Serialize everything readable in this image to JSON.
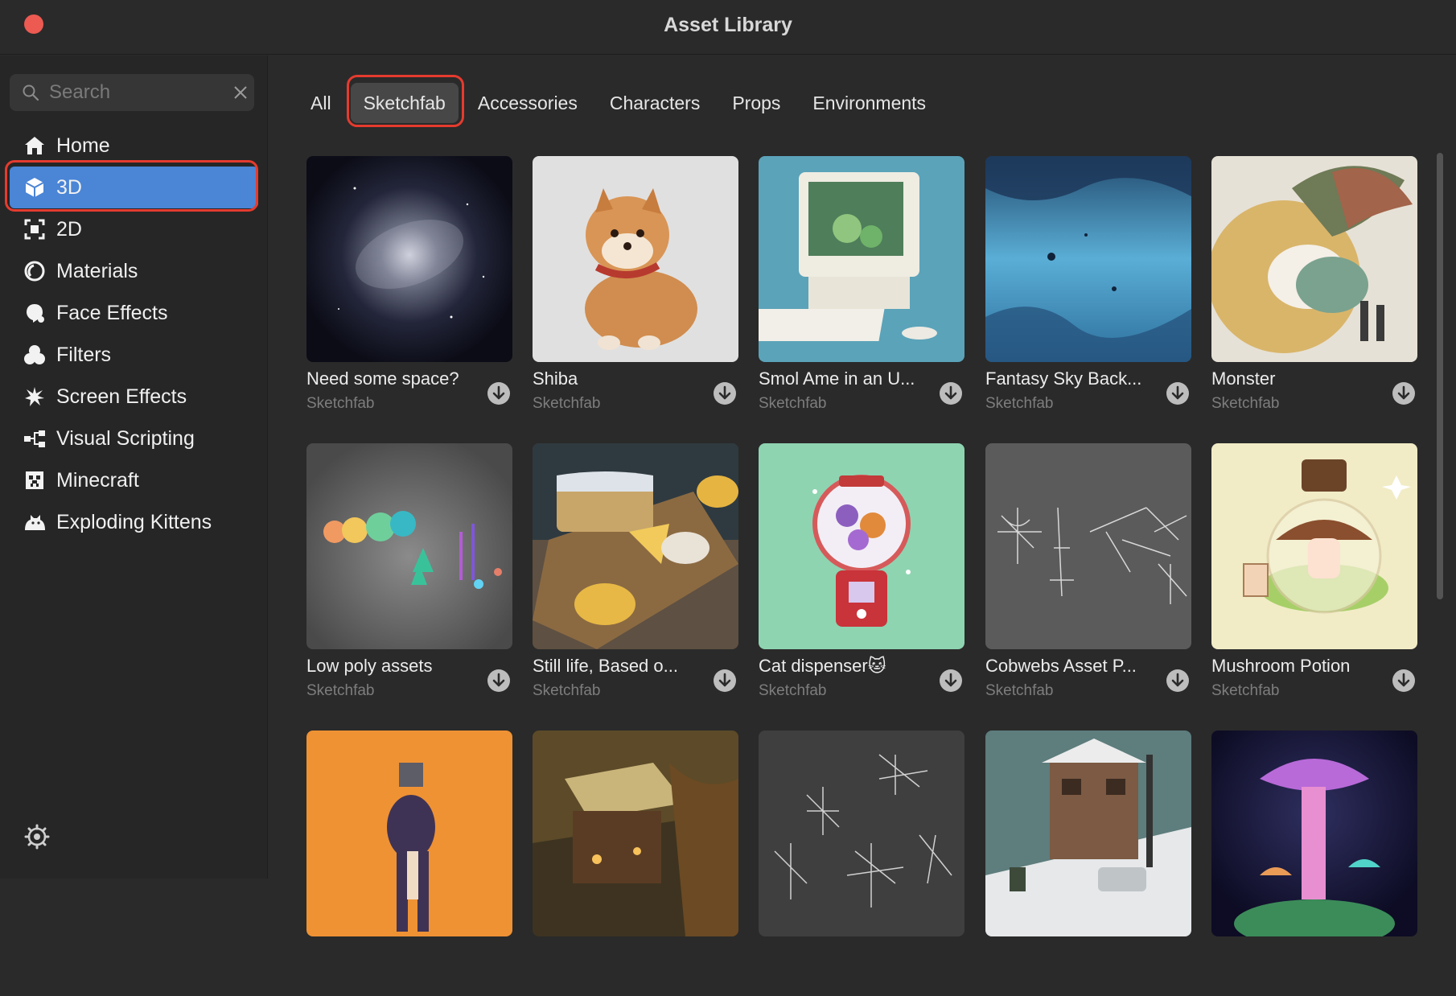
{
  "window": {
    "title": "Asset Library"
  },
  "search": {
    "placeholder": "Search",
    "value": ""
  },
  "sidebar": {
    "items": [
      {
        "label": "Home",
        "icon": "home-icon"
      },
      {
        "label": "3D",
        "icon": "cube-icon",
        "active": true
      },
      {
        "label": "2D",
        "icon": "frame-icon"
      },
      {
        "label": "Materials",
        "icon": "materials-icon"
      },
      {
        "label": "Face Effects",
        "icon": "face-effects-icon"
      },
      {
        "label": "Filters",
        "icon": "filters-icon"
      },
      {
        "label": "Screen Effects",
        "icon": "screen-effects-icon"
      },
      {
        "label": "Visual Scripting",
        "icon": "visual-scripting-icon"
      },
      {
        "label": "Minecraft",
        "icon": "minecraft-icon"
      },
      {
        "label": "Exploding Kittens",
        "icon": "exploding-kittens-icon"
      }
    ]
  },
  "tabs": [
    {
      "label": "All"
    },
    {
      "label": "Sketchfab",
      "active": true
    },
    {
      "label": "Accessories"
    },
    {
      "label": "Characters"
    },
    {
      "label": "Props"
    },
    {
      "label": "Environments"
    }
  ],
  "assets": [
    {
      "title": "Need some space?",
      "source": "Sketchfab"
    },
    {
      "title": "Shiba",
      "source": "Sketchfab"
    },
    {
      "title": "Smol Ame in an U...",
      "source": "Sketchfab"
    },
    {
      "title": "Fantasy Sky Back...",
      "source": "Sketchfab"
    },
    {
      "title": "Monster",
      "source": "Sketchfab"
    },
    {
      "title": "Low poly assets",
      "source": "Sketchfab"
    },
    {
      "title": "Still life, Based o...",
      "source": "Sketchfab"
    },
    {
      "title": "Cat dispenser🐱",
      "source": "Sketchfab"
    },
    {
      "title": "Cobwebs Asset P...",
      "source": "Sketchfab"
    },
    {
      "title": "Mushroom Potion",
      "source": "Sketchfab"
    },
    {
      "title": "",
      "source": ""
    },
    {
      "title": "",
      "source": ""
    },
    {
      "title": "",
      "source": ""
    },
    {
      "title": "",
      "source": ""
    },
    {
      "title": "",
      "source": ""
    }
  ],
  "colors": {
    "accent": "#4a85d6",
    "highlight_ring": "#e53b2f",
    "close_button": "#ec5a52"
  }
}
